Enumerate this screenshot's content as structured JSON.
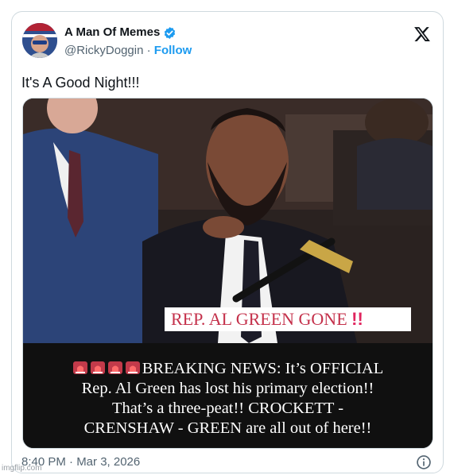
{
  "tweet": {
    "author_name": "A Man Of Memes",
    "handle": "@RickyDoggin",
    "separator": " · ",
    "follow_label": "Follow",
    "text": "It's A Good Night!!!",
    "timestamp": "8:40 PM · Mar 3, 2026"
  },
  "media": {
    "overlay_label": "REP. AL GREEN GONE",
    "overlay_emphasis": "!!",
    "caption_line1": "BREAKING NEWS: It’s OFFICIAL",
    "caption_line2": "Rep. Al Green has lost his primary election!!",
    "caption_line3": "That’s a three-peat!! CROCKETT -",
    "caption_line4": "CRENSHAW - GREEN are all out of here!!"
  },
  "watermark": "imgflip.com",
  "icons": [
    "verified-badge-icon",
    "x-logo-icon",
    "info-icon",
    "siren-icon"
  ],
  "colors": {
    "follow": "#1d9bf0",
    "verified": "#1d9bf0",
    "label_red": "#c4314b"
  }
}
